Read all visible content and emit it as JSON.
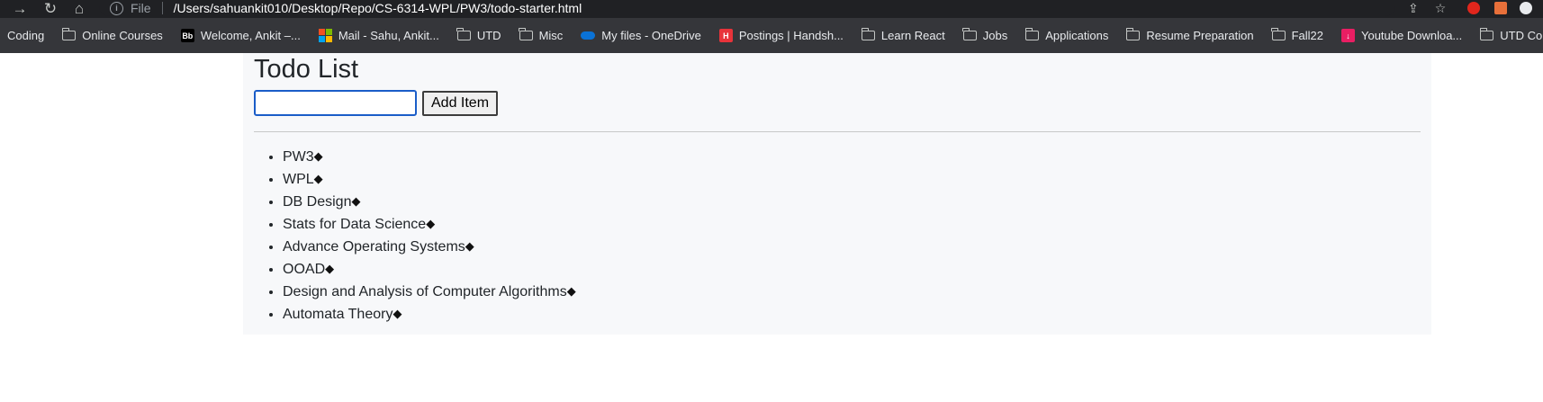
{
  "browser": {
    "scheme_label": "File",
    "url": "/Users/sahuankit010/Desktop/Repo/CS-6314-WPL/PW3/todo-starter.html",
    "bookmarks": [
      {
        "label": "Coding",
        "icon": "none"
      },
      {
        "label": "Online Courses",
        "icon": "folder-icon"
      },
      {
        "label": "Welcome, Ankit –...",
        "icon": "blackboard-icon"
      },
      {
        "label": "Mail - Sahu, Ankit...",
        "icon": "microsoft-icon"
      },
      {
        "label": "UTD",
        "icon": "folder-icon"
      },
      {
        "label": "Misc",
        "icon": "folder-icon"
      },
      {
        "label": "My files - OneDrive",
        "icon": "onedrive-icon"
      },
      {
        "label": "Postings | Handsh...",
        "icon": "handshake-icon"
      },
      {
        "label": "Learn React",
        "icon": "folder-icon"
      },
      {
        "label": "Jobs",
        "icon": "folder-icon"
      },
      {
        "label": "Applications",
        "icon": "folder-icon"
      },
      {
        "label": "Resume Preparation",
        "icon": "folder-icon"
      },
      {
        "label": "Fall22",
        "icon": "folder-icon"
      },
      {
        "label": "Youtube Downloa...",
        "icon": "download-icon"
      },
      {
        "label": "UTD Courses",
        "icon": "folder-icon"
      }
    ]
  },
  "page": {
    "title": "Todo List",
    "input_value": "",
    "add_button_label": "Add Item",
    "delete_glyph": "◆",
    "items": [
      "PW3",
      "WPL",
      "DB Design",
      "Stats for Data Science",
      "Advance Operating Systems",
      "OOAD",
      "Design and Analysis of Computer Algorithms",
      "Automata Theory"
    ]
  }
}
